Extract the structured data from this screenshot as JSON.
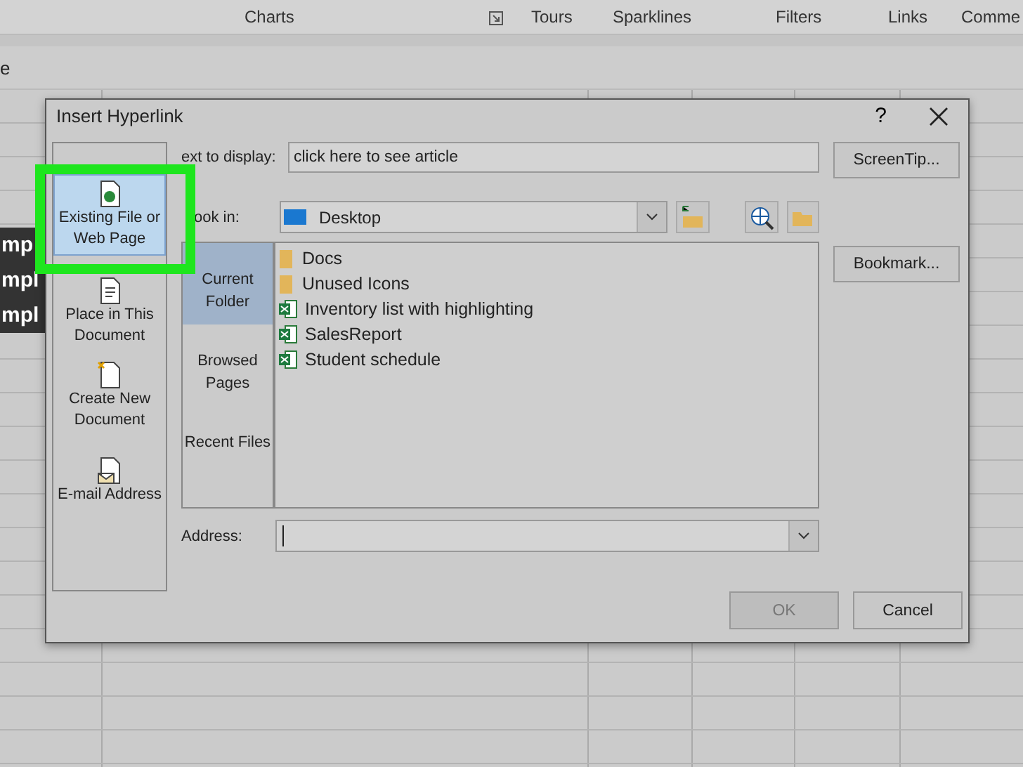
{
  "ribbon": {
    "groups": [
      "Charts",
      "Tours",
      "Sparklines",
      "Filters",
      "Links",
      "Comme"
    ]
  },
  "formula_bar": {
    "text": "e"
  },
  "sheet": {
    "cells": [
      "mp",
      "mpl",
      "mpl"
    ]
  },
  "dialog": {
    "title": "Insert Hyperlink",
    "help": "?",
    "link_to": [
      {
        "label": "Existing File or Web Page",
        "kind": "file",
        "selected": true
      },
      {
        "label": "Place in This Document",
        "kind": "place",
        "selected": false
      },
      {
        "label": "Create New Document",
        "kind": "new",
        "selected": false
      },
      {
        "label": "E-mail Address",
        "kind": "mail",
        "selected": false
      }
    ],
    "text_to_display": {
      "label": "ext to display:",
      "value": "click here to see article"
    },
    "look_in": {
      "label": "ook in:",
      "value": "Desktop"
    },
    "views": [
      {
        "label": "Current Folder",
        "selected": true
      },
      {
        "label": "Browsed Pages",
        "selected": false
      },
      {
        "label": "Recent Files",
        "selected": false
      }
    ],
    "files": [
      {
        "name": "Docs",
        "kind": "folder"
      },
      {
        "name": "Unused Icons",
        "kind": "folder"
      },
      {
        "name": "Inventory list with highlighting",
        "kind": "excel"
      },
      {
        "name": "SalesReport",
        "kind": "excel"
      },
      {
        "name": "Student schedule",
        "kind": "excel"
      }
    ],
    "address": {
      "label": "Address:"
    },
    "screentip": "ScreenTip...",
    "bookmark": "Bookmark...",
    "ok": {
      "label": "OK",
      "disabled": true
    },
    "cancel": {
      "label": "Cancel",
      "disabled": false
    }
  }
}
